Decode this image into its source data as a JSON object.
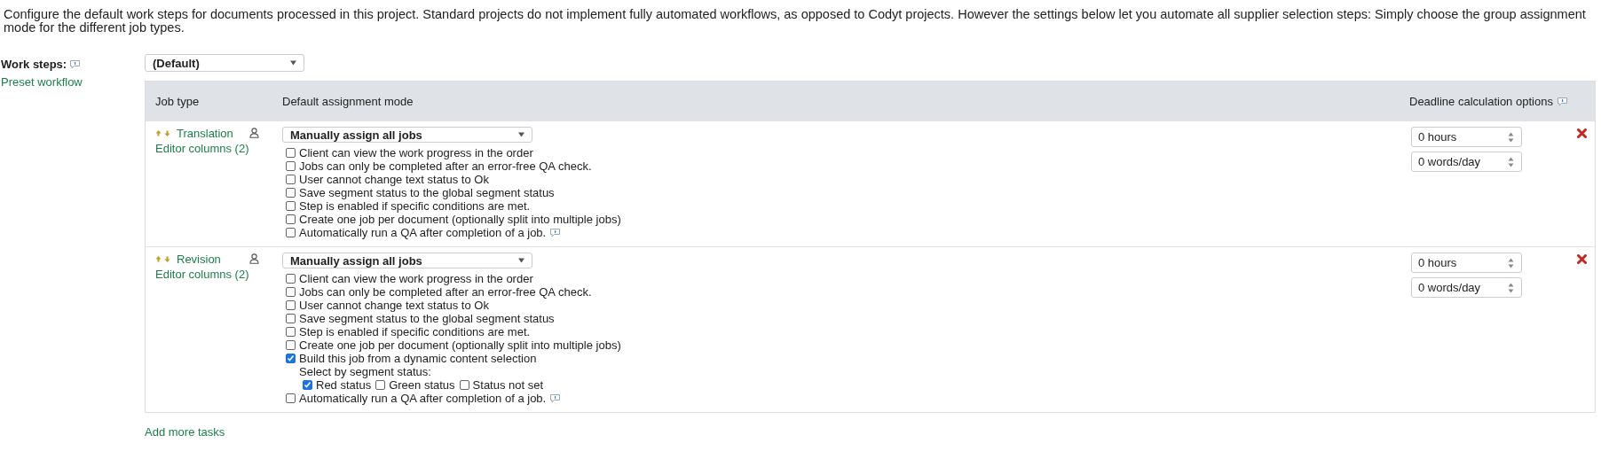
{
  "intro": "Configure the default work steps for documents processed in this project. Standard projects do not implement fully automated workflows, as opposed to Codyt projects. However the settings below let you automate all supplier selection steps: Simply choose the group assignment mode for the different job types.",
  "work_steps": {
    "label": "Work steps:",
    "link": "Preset workflow",
    "select": "(Default)"
  },
  "table": {
    "columns": [
      "Job type",
      "Default assignment mode",
      "Deadline calculation options"
    ],
    "rows": [
      {
        "job_type": "Translation",
        "editor_columns": "Editor columns (2)",
        "assignment_mode": "Manually assign all jobs",
        "hours": "0 hours",
        "words_per_day": "0 words/day",
        "options": [
          {
            "kind": "checkbox",
            "label": "Client can view the work progress in the order",
            "checked": false
          },
          {
            "kind": "checkbox",
            "label": "Jobs can only be completed after an error-free QA check.",
            "checked": false
          },
          {
            "kind": "checkbox",
            "label": "User cannot change text status to Ok",
            "checked": false
          },
          {
            "kind": "checkbox",
            "label": "Save segment status to the global segment status",
            "checked": false
          },
          {
            "kind": "checkbox",
            "label": "Step is enabled if specific conditions are met.",
            "checked": false
          },
          {
            "kind": "checkbox",
            "label": "Create one job per document (optionally split into multiple jobs)",
            "checked": false
          },
          {
            "kind": "help_checkbox",
            "label": "Automatically run a QA after completion of a job.",
            "checked": false
          }
        ]
      },
      {
        "job_type": "Revision",
        "editor_columns": "Editor columns (2)",
        "assignment_mode": "Manually assign all jobs",
        "hours": "0 hours",
        "words_per_day": "0 words/day",
        "options": [
          {
            "kind": "checkbox",
            "label": "Client can view the work progress in the order",
            "checked": false
          },
          {
            "kind": "checkbox",
            "label": "Jobs can only be completed after an error-free QA check.",
            "checked": false
          },
          {
            "kind": "checkbox",
            "label": "User cannot change text status to Ok",
            "checked": false
          },
          {
            "kind": "checkbox",
            "label": "Save segment status to the global segment status",
            "checked": false
          },
          {
            "kind": "checkbox",
            "label": "Step is enabled if specific conditions are met.",
            "checked": false
          },
          {
            "kind": "checkbox",
            "label": "Create one job per document (optionally split into multiple jobs)",
            "checked": false
          },
          {
            "kind": "selection_checkbox",
            "label": "Build this job from a dynamic content selection",
            "checked": true,
            "sub_label": "Select by segment status:",
            "sub_options": [
              {
                "label": "Red status",
                "checked": true
              },
              {
                "label": "Green status",
                "checked": false
              },
              {
                "label": "Status not set",
                "checked": false
              }
            ]
          },
          {
            "kind": "help_checkbox",
            "label": "Automatically run a QA after completion of a job.",
            "checked": false
          }
        ]
      }
    ]
  },
  "add_link": "Add more tasks"
}
